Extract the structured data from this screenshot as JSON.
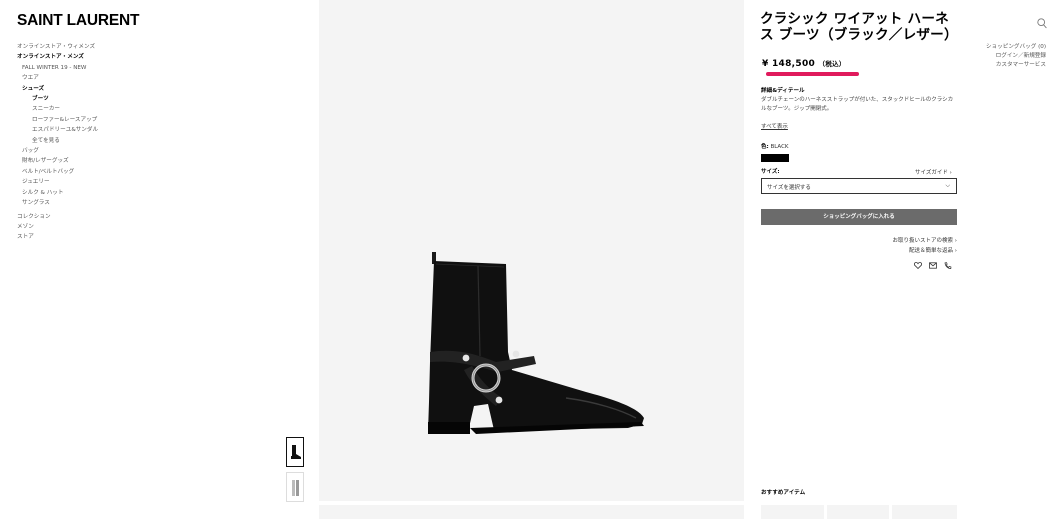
{
  "brand": {
    "logo": "SAINT LAURENT"
  },
  "nav": {
    "items": [
      {
        "label": "オンラインストア・ウィメンズ",
        "level": 0,
        "bold": false
      },
      {
        "label": "オンラインストア・メンズ",
        "level": 0,
        "bold": true
      },
      {
        "label": "FALL WINTER 19 - NEW",
        "level": 1,
        "bold": false
      },
      {
        "label": "ウエア",
        "level": 1,
        "bold": false
      },
      {
        "label": "シューズ",
        "level": 1,
        "bold": true
      },
      {
        "label": "ブーツ",
        "level": 2,
        "bold": true
      },
      {
        "label": "スニーカー",
        "level": 2,
        "bold": false
      },
      {
        "label": "ローファー&レースアップ",
        "level": 2,
        "bold": false
      },
      {
        "label": "エスパドリーユ&サンダル",
        "level": 2,
        "bold": false
      },
      {
        "label": "全てを見る",
        "level": 2,
        "bold": false
      },
      {
        "label": "バッグ",
        "level": 1,
        "bold": false
      },
      {
        "label": "財布/レザーグッズ",
        "level": 1,
        "bold": false
      },
      {
        "label": "ベルト/ベルトバッグ",
        "level": 1,
        "bold": false
      },
      {
        "label": "ジュエリー",
        "level": 1,
        "bold": false
      },
      {
        "label": "シルク & ハット",
        "level": 1,
        "bold": false
      },
      {
        "label": "サングラス",
        "level": 1,
        "bold": false
      },
      {
        "label": "コレクション",
        "level": 0,
        "bold": false,
        "gap": true
      },
      {
        "label": "メゾン",
        "level": 0,
        "bold": false
      },
      {
        "label": "ストア",
        "level": 0,
        "bold": false
      }
    ]
  },
  "product": {
    "title": "クラシック ワイアット ハーネス ブーツ（ブラック／レザー）",
    "price": "¥ 148,500",
    "price_tax": "（税込）",
    "details_heading": "詳細&ディテール",
    "details_text": "ダブルチェーンのハーネスストラップが付いた、スタックドヒールのクラシカルなブーツ。ジップ開閉式。",
    "show_all": "すべて表示",
    "color_label": "色:",
    "color_value": "BLACK",
    "color_hex": "#000000",
    "size_label": "サイズ:",
    "size_guide": "サイズガイド ›",
    "size_placeholder": "サイズを選択する",
    "add_to_bag": "ショッピングバッグに入れる",
    "find_store": "お取り扱いストアの検索 ›",
    "delivery": "配送＆簡単な返品 ›",
    "recommended": "おすすめアイテム"
  },
  "utility": {
    "bag": "ショッピングバッグ (0)",
    "login": "ログイン／新規登録",
    "customer_service": "カスタマーサービス"
  },
  "icons": [
    "search-icon",
    "heart-icon",
    "mail-icon",
    "phone-icon",
    "chevron-down-icon"
  ],
  "colors": {
    "accent": "#e01a5c",
    "button": "#6b6b6b",
    "image_bg": "#f4f4f4"
  }
}
